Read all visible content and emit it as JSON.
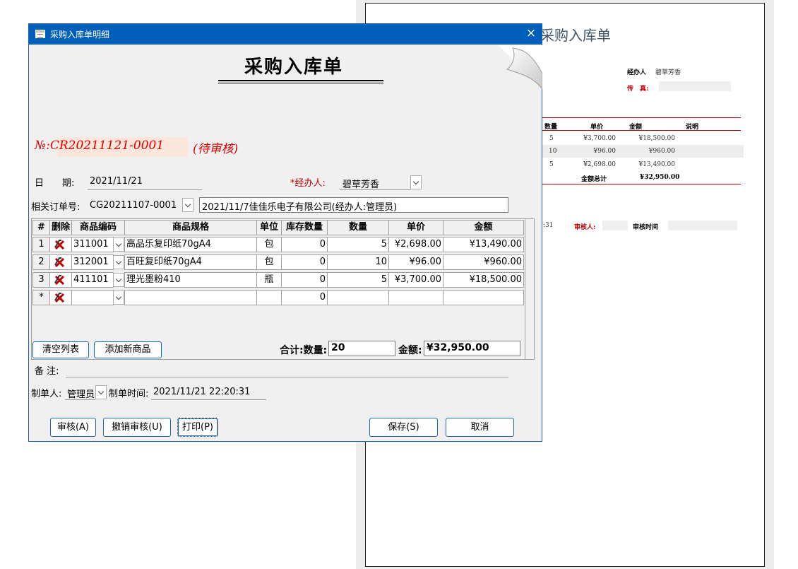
{
  "preview": {
    "title": "采购入库单",
    "handler_label": "经办人",
    "handler_value": "碧草芳香",
    "fax_label": "传　真:",
    "columns": [
      "数量",
      "单价",
      "金额",
      "说明"
    ],
    "rows": [
      {
        "qty": "5",
        "price": "¥3,700.00",
        "amount": "¥18,500.00"
      },
      {
        "qty": "10",
        "price": "¥96.00",
        "amount": "¥960.00"
      },
      {
        "qty": "5",
        "price": "¥2,698.00",
        "amount": "¥13,490.00"
      }
    ],
    "total_label": "金额总计",
    "total_value": "¥32,950.00",
    "time_fragment": ":31",
    "reviewer_label": "审核人:",
    "review_time_label": "审核时间"
  },
  "window": {
    "title": "采购入库单明细",
    "close": "×"
  },
  "form": {
    "title": "采购入库单",
    "doc_no": "№:CR20211121-0001",
    "status": "(待审核)",
    "date_label": "日　　期:",
    "date_value": "2021/11/21",
    "handler_label": "*经办人:",
    "handler_value": "碧草芳香",
    "order_label": "相关订单号:",
    "order_value": "CG20211107-0001",
    "order_desc": "2021/11/7佳佳乐电子有限公司(经办人:管理员)"
  },
  "grid": {
    "headers": [
      "#",
      "删除",
      "商品编码",
      "商品规格",
      "单位",
      "库存数量",
      "数量",
      "单价",
      "金额"
    ],
    "rows": [
      {
        "no": "1",
        "code": "311001",
        "spec": "高品乐复印纸70gA4",
        "unit": "包",
        "stock": "0",
        "qty": "5",
        "price": "¥2,698.00",
        "amount": "¥13,490.00"
      },
      {
        "no": "2",
        "code": "312001",
        "spec": "百旺复印纸70gA4",
        "unit": "包",
        "stock": "0",
        "qty": "10",
        "price": "¥96.00",
        "amount": "¥960.00"
      },
      {
        "no": "3",
        "code": "411101",
        "spec": "理光墨粉410",
        "unit": "瓶",
        "stock": "0",
        "qty": "5",
        "price": "¥3,700.00",
        "amount": "¥18,500.00"
      }
    ],
    "new_row": {
      "no": "*",
      "stock": "0"
    }
  },
  "actions": {
    "clear_list": "清空列表",
    "add_product": "添加新商品"
  },
  "totals": {
    "label": "合计:数量:",
    "qty": "20",
    "amount_label": "金额:",
    "amount": "¥32,950.00"
  },
  "footer": {
    "remark_label": "备 注:",
    "maker_label": "制单人:",
    "maker_value": "管理员",
    "make_time_label": "制单时间:",
    "make_time_value": "2021/11/21 22:20:31"
  },
  "buttons": {
    "approve": "审核(A)",
    "revoke": "撤销审核(U)",
    "print": "打印(P)",
    "save": "保存(S)",
    "cancel": "取消"
  },
  "colors": {
    "titlebar": "#005fb8",
    "accent_red": "#e00000",
    "button_border": "#1a66c2"
  }
}
